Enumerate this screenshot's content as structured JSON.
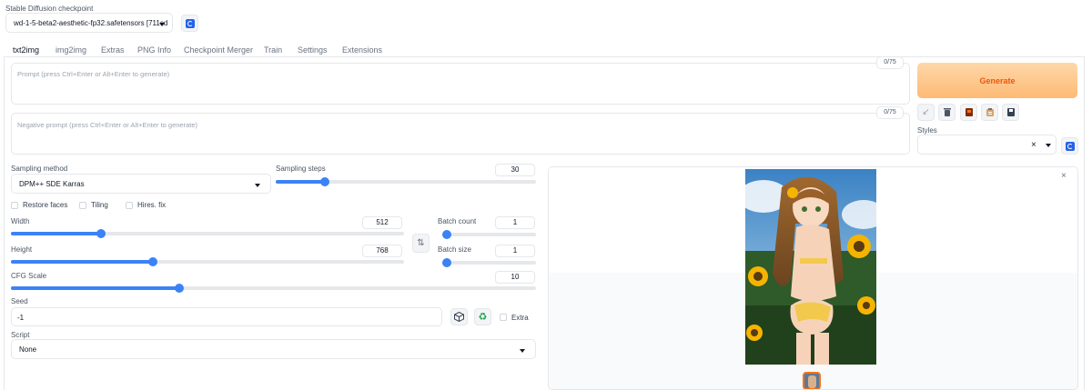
{
  "checkpoint": {
    "label": "Stable Diffusion checkpoint",
    "value": "wd-1-5-beta2-aesthetic-fp32.safetensors [711cd"
  },
  "tabs": [
    {
      "label": "txt2img",
      "active": true
    },
    {
      "label": "img2img"
    },
    {
      "label": "Extras"
    },
    {
      "label": "PNG Info"
    },
    {
      "label": "Checkpoint Merger"
    },
    {
      "label": "Train"
    },
    {
      "label": "Settings"
    },
    {
      "label": "Extensions"
    }
  ],
  "prompt": {
    "placeholder": "Prompt (press Ctrl+Enter or Alt+Enter to generate)",
    "counter": "0/75"
  },
  "negative_prompt": {
    "placeholder": "Negative prompt (press Ctrl+Enter or Alt+Enter to generate)",
    "counter": "0/75"
  },
  "generate_label": "Generate",
  "styles": {
    "label": "Styles",
    "clear": "×"
  },
  "sampling": {
    "method_label": "Sampling method",
    "method_value": "DPM++ SDE Karras",
    "steps_label": "Sampling steps",
    "steps_value": "30",
    "steps_fraction": 0.19
  },
  "options": {
    "restore_faces": "Restore faces",
    "tiling": "Tiling",
    "hires_fix": "Hires. fix"
  },
  "width": {
    "label": "Width",
    "value": "512",
    "fraction": 0.23
  },
  "height": {
    "label": "Height",
    "value": "768",
    "fraction": 0.36
  },
  "batch_count": {
    "label": "Batch count",
    "value": "1",
    "fraction": 0.0
  },
  "batch_size": {
    "label": "Batch size",
    "value": "1",
    "fraction": 0.0
  },
  "cfg": {
    "label": "CFG Scale",
    "value": "10",
    "fraction": 0.32
  },
  "swap_icon": "⇅",
  "seed": {
    "label": "Seed",
    "value": "-1",
    "extra_label": "Extra"
  },
  "script": {
    "label": "Script",
    "value": "None"
  },
  "output": {
    "close": "×"
  },
  "colors": {
    "accent": "#3b82f6",
    "generate_bg": "#fdba74",
    "generate_text": "#ea580c",
    "refresh": "#2563eb"
  }
}
